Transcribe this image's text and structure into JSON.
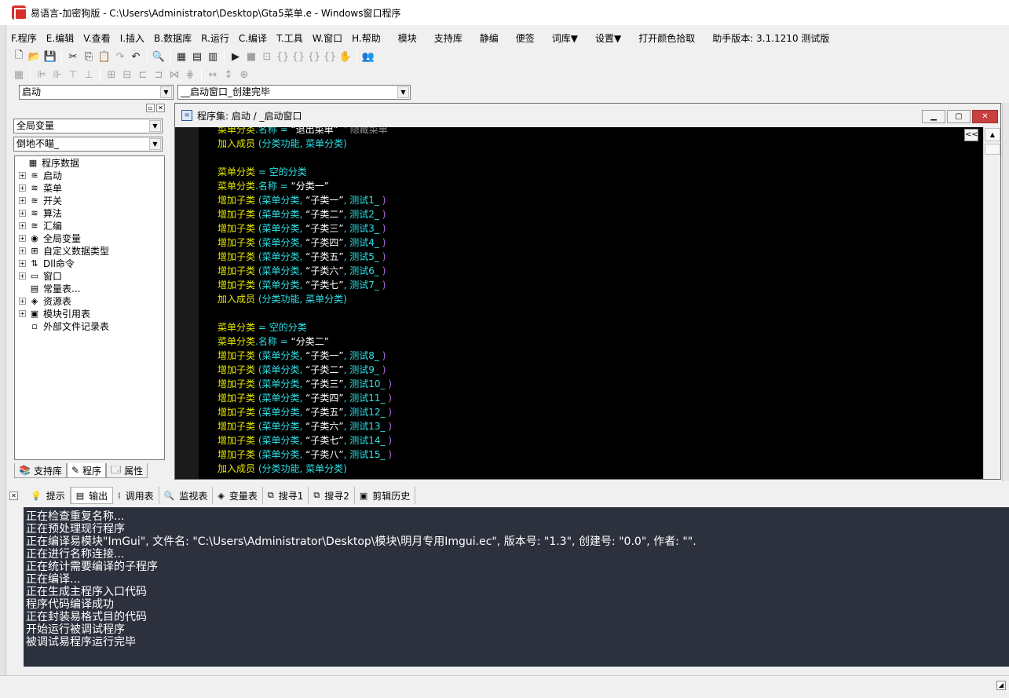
{
  "title": "易语言-加密狗版 - C:\\Users\\Administrator\\Desktop\\Gta5菜单.e - Windows窗口程序",
  "menu": [
    "F.程序",
    "E.编辑",
    "V.查看",
    "I.插入",
    "B.数据库",
    "R.运行",
    "C.编译",
    "T.工具",
    "W.窗口",
    "H.帮助",
    "模块",
    "支持库",
    "静编",
    "便签",
    "词库▼",
    "设置▼",
    "打开颜色拾取",
    "助手版本: 3.1.1210 测试版"
  ],
  "toolbar": {
    "row1": [
      "new-file-icon",
      "open-folder-icon",
      "save-icon",
      "cut-icon",
      "copy-icon",
      "paste-icon",
      "redo-icon",
      "undo-icon",
      "find-icon",
      "layout-icon",
      "split-h-icon",
      "split-v-icon",
      "run-icon",
      "stop-icon",
      "step-icon",
      "step-over-icon",
      "step-into-icon",
      "step-out-icon",
      "run-to-icon",
      "hand-icon",
      "binoculars-icon"
    ],
    "row2": [
      "grid-icon",
      "align-left-icon",
      "align-right-icon",
      "align-top-icon",
      "align-bottom-icon",
      "center-h-icon",
      "center-v-icon",
      "same-width-icon",
      "same-height-icon",
      "space-h-icon",
      "space-v-icon",
      "width-icon",
      "height-icon",
      "size-icon"
    ]
  },
  "selectors": {
    "target_combo": "启动",
    "event_combo": "__启动窗口_创建完毕"
  },
  "left_panel": {
    "scope_combo": "全局变量",
    "filter_combo": "倒地不瞄_",
    "tree": [
      {
        "label": "程序数据",
        "icon": "program-data-icon",
        "level": 0,
        "expander": ""
      },
      {
        "label": "启动",
        "icon": "program-set-icon",
        "level": 1,
        "expander": "+"
      },
      {
        "label": "菜单",
        "icon": "program-set-icon",
        "level": 1,
        "expander": "+"
      },
      {
        "label": "开关",
        "icon": "program-set-icon",
        "level": 1,
        "expander": "+"
      },
      {
        "label": "算法",
        "icon": "program-set-icon",
        "level": 1,
        "expander": "+"
      },
      {
        "label": "汇编",
        "icon": "program-set-icon",
        "level": 1,
        "expander": "+"
      },
      {
        "label": "全局变量",
        "icon": "global-var-icon",
        "level": 1,
        "expander": "+"
      },
      {
        "label": "自定义数据类型",
        "icon": "custom-type-icon",
        "level": 1,
        "expander": "+"
      },
      {
        "label": "Dll命令",
        "icon": "dll-command-icon",
        "level": 1,
        "expander": "+"
      },
      {
        "label": "窗口",
        "icon": "window-icon",
        "level": 1,
        "expander": "+"
      },
      {
        "label": "常量表...",
        "icon": "constant-table-icon",
        "level": 1,
        "expander": ""
      },
      {
        "label": "资源表",
        "icon": "resource-table-icon",
        "level": 1,
        "expander": "+"
      },
      {
        "label": "模块引用表",
        "icon": "module-ref-icon",
        "level": 1,
        "expander": "+"
      },
      {
        "label": "外部文件记录表",
        "icon": "external-file-icon",
        "level": 1,
        "expander": ""
      }
    ],
    "tabs": [
      "支持库",
      "程序",
      "属性"
    ]
  },
  "code_window": {
    "title": "程序集: 启动 / _启动窗口",
    "collapse_label": "<<",
    "lines": [
      [
        {
          "t": "菜单分类",
          "c": "kw"
        },
        {
          "t": ".名称",
          "c": "vr"
        },
        {
          "t": " = ",
          "c": "vr"
        },
        {
          "t": "“退出菜单”",
          "c": "st"
        },
        {
          "t": "  ' 隐藏菜单",
          "c": "cm"
        }
      ],
      [
        {
          "t": "加入成员",
          "c": "kw"
        },
        {
          "t": " (分类功能, 菜单分类)",
          "c": "vr"
        }
      ],
      [],
      [
        {
          "t": "菜单分类",
          "c": "kw"
        },
        {
          "t": " = ",
          "c": "vr"
        },
        {
          "t": "空的分类",
          "c": "vr"
        }
      ],
      [
        {
          "t": "菜单分类",
          "c": "kw"
        },
        {
          "t": ".名称",
          "c": "vr"
        },
        {
          "t": " = ",
          "c": "vr"
        },
        {
          "t": "“分类一”",
          "c": "st"
        }
      ],
      [
        {
          "t": "增加子类",
          "c": "kw"
        },
        {
          "t": " (菜单分类, ",
          "c": "vr"
        },
        {
          "t": "“子类一”",
          "c": "st"
        },
        {
          "t": ", 测试1_ ",
          "c": "vr"
        },
        {
          "t": ")",
          "c": "pp"
        }
      ],
      [
        {
          "t": "增加子类",
          "c": "kw"
        },
        {
          "t": " (菜单分类, ",
          "c": "vr"
        },
        {
          "t": "“子类二”",
          "c": "st"
        },
        {
          "t": ", 测试2_ ",
          "c": "vr"
        },
        {
          "t": ")",
          "c": "pp"
        }
      ],
      [
        {
          "t": "增加子类",
          "c": "kw"
        },
        {
          "t": " (菜单分类, ",
          "c": "vr"
        },
        {
          "t": "“子类三”",
          "c": "st"
        },
        {
          "t": ", 测试3_ ",
          "c": "vr"
        },
        {
          "t": ")",
          "c": "pp"
        }
      ],
      [
        {
          "t": "增加子类",
          "c": "kw"
        },
        {
          "t": " (菜单分类, ",
          "c": "vr"
        },
        {
          "t": "“子类四”",
          "c": "st"
        },
        {
          "t": ", 测试4_ ",
          "c": "vr"
        },
        {
          "t": ")",
          "c": "pp"
        }
      ],
      [
        {
          "t": "增加子类",
          "c": "kw"
        },
        {
          "t": " (菜单分类, ",
          "c": "vr"
        },
        {
          "t": "“子类五”",
          "c": "st"
        },
        {
          "t": ", 测试5_ ",
          "c": "vr"
        },
        {
          "t": ")",
          "c": "pp"
        }
      ],
      [
        {
          "t": "增加子类",
          "c": "kw"
        },
        {
          "t": " (菜单分类, ",
          "c": "vr"
        },
        {
          "t": "“子类六”",
          "c": "st"
        },
        {
          "t": ", 测试6_ ",
          "c": "vr"
        },
        {
          "t": ")",
          "c": "pp"
        }
      ],
      [
        {
          "t": "增加子类",
          "c": "kw"
        },
        {
          "t": " (菜单分类, ",
          "c": "vr"
        },
        {
          "t": "“子类七”",
          "c": "st"
        },
        {
          "t": ", 测试7_ ",
          "c": "vr"
        },
        {
          "t": ")",
          "c": "pp"
        }
      ],
      [
        {
          "t": "加入成员",
          "c": "kw"
        },
        {
          "t": " (分类功能, 菜单分类)",
          "c": "vr"
        }
      ],
      [],
      [
        {
          "t": "菜单分类",
          "c": "kw"
        },
        {
          "t": " = ",
          "c": "vr"
        },
        {
          "t": "空的分类",
          "c": "vr"
        }
      ],
      [
        {
          "t": "菜单分类",
          "c": "kw"
        },
        {
          "t": ".名称",
          "c": "vr"
        },
        {
          "t": " = ",
          "c": "vr"
        },
        {
          "t": "“分类二”",
          "c": "st"
        }
      ],
      [
        {
          "t": "增加子类",
          "c": "kw"
        },
        {
          "t": " (菜单分类, ",
          "c": "vr"
        },
        {
          "t": "“子类一”",
          "c": "st"
        },
        {
          "t": ", 测试8_ ",
          "c": "vr"
        },
        {
          "t": ")",
          "c": "pp"
        }
      ],
      [
        {
          "t": "增加子类",
          "c": "kw"
        },
        {
          "t": " (菜单分类, ",
          "c": "vr"
        },
        {
          "t": "“子类二”",
          "c": "st"
        },
        {
          "t": ", 测试9_ ",
          "c": "vr"
        },
        {
          "t": ")",
          "c": "pp"
        }
      ],
      [
        {
          "t": "增加子类",
          "c": "kw"
        },
        {
          "t": " (菜单分类, ",
          "c": "vr"
        },
        {
          "t": "“子类三”",
          "c": "st"
        },
        {
          "t": ", 测试10_ ",
          "c": "vr"
        },
        {
          "t": ")",
          "c": "pp"
        }
      ],
      [
        {
          "t": "增加子类",
          "c": "kw"
        },
        {
          "t": " (菜单分类, ",
          "c": "vr"
        },
        {
          "t": "“子类四”",
          "c": "st"
        },
        {
          "t": ", 测试11_ ",
          "c": "vr"
        },
        {
          "t": ")",
          "c": "pp"
        }
      ],
      [
        {
          "t": "增加子类",
          "c": "kw"
        },
        {
          "t": " (菜单分类, ",
          "c": "vr"
        },
        {
          "t": "“子类五”",
          "c": "st"
        },
        {
          "t": ", 测试12_ ",
          "c": "vr"
        },
        {
          "t": ")",
          "c": "pp"
        }
      ],
      [
        {
          "t": "增加子类",
          "c": "kw"
        },
        {
          "t": " (菜单分类, ",
          "c": "vr"
        },
        {
          "t": "“子类六”",
          "c": "st"
        },
        {
          "t": ", 测试13_ ",
          "c": "vr"
        },
        {
          "t": ")",
          "c": "pp"
        }
      ],
      [
        {
          "t": "增加子类",
          "c": "kw"
        },
        {
          "t": " (菜单分类, ",
          "c": "vr"
        },
        {
          "t": "“子类七”",
          "c": "st"
        },
        {
          "t": ", 测试14_ ",
          "c": "vr"
        },
        {
          "t": ")",
          "c": "pp"
        }
      ],
      [
        {
          "t": "增加子类",
          "c": "kw"
        },
        {
          "t": " (菜单分类, ",
          "c": "vr"
        },
        {
          "t": "“子类八”",
          "c": "st"
        },
        {
          "t": ", 测试15_ ",
          "c": "vr"
        },
        {
          "t": ")",
          "c": "pp"
        }
      ],
      [
        {
          "t": "加入成员",
          "c": "kw"
        },
        {
          "t": " (分类功能, 菜单分类)",
          "c": "vr"
        }
      ]
    ]
  },
  "output_tabs": [
    {
      "label": "提示",
      "icon": "hint-icon"
    },
    {
      "label": "输出",
      "icon": "output-icon"
    },
    {
      "label": "调用表",
      "icon": "call-stack-icon"
    },
    {
      "label": "监视表",
      "icon": "watch-icon"
    },
    {
      "label": "变量表",
      "icon": "variables-icon"
    },
    {
      "label": "搜寻1",
      "icon": "search1-icon"
    },
    {
      "label": "搜寻2",
      "icon": "search2-icon"
    },
    {
      "label": "剪辑历史",
      "icon": "clip-history-icon"
    }
  ],
  "output_lines": [
    "正在检查重复名称...",
    "正在预处理现行程序",
    "正在编译易模块\"ImGui\", 文件名: \"C:\\Users\\Administrator\\Desktop\\模块\\明月专用Imgui.ec\", 版本号: \"1.3\", 创建号: \"0.0\", 作者: \"\".",
    "正在进行名称连接...",
    "正在统计需要编译的子程序",
    "正在编译...",
    "正在生成主程序入口代码",
    "程序代码编译成功",
    "正在封装易格式目的代码",
    "开始运行被调试程序",
    "被调试易程序运行完毕"
  ],
  "colors": {
    "code_background": "#000000",
    "keyword": "#e6e600",
    "identifier": "#2ee0e6",
    "string": "#ffffff",
    "comment": "#8e8e8e",
    "output_background": "#2c313d"
  }
}
